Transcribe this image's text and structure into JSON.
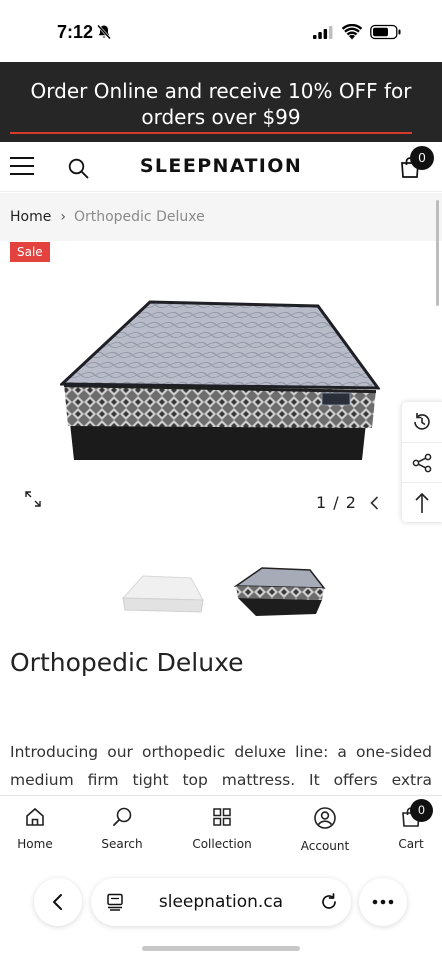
{
  "status_bar": {
    "time": "7:12"
  },
  "promo": {
    "text": "Order Online and receive 10% OFF for orders over $99",
    "line_color": "#d63a2a"
  },
  "header": {
    "logo": "SLEEPNATION",
    "cart_count": "0"
  },
  "breadcrumb": {
    "home": "Home",
    "separator": "›",
    "current": "Orthopedic Deluxe"
  },
  "product": {
    "sale_badge": "Sale",
    "slide_counter": "1 / 2",
    "title": "Orthopedic Deluxe",
    "description": "Introducing our orthopedic deluxe line: a one-sided medium firm tight top mattress. It offers extra support",
    "badge_color": "#e4423f"
  },
  "side_tools": {
    "icons": [
      "history-icon",
      "share-icon",
      "back-to-top-icon"
    ]
  },
  "bottom_nav": {
    "items": [
      {
        "label": "Home",
        "icon": "home-icon"
      },
      {
        "label": "Search",
        "icon": "search-icon"
      },
      {
        "label": "Collection",
        "icon": "grid-icon"
      },
      {
        "label": "Account",
        "icon": "account-icon"
      },
      {
        "label": "Cart",
        "icon": "bag-icon"
      }
    ],
    "cart_count": "0"
  },
  "browser": {
    "url": "sleepnation.ca"
  }
}
